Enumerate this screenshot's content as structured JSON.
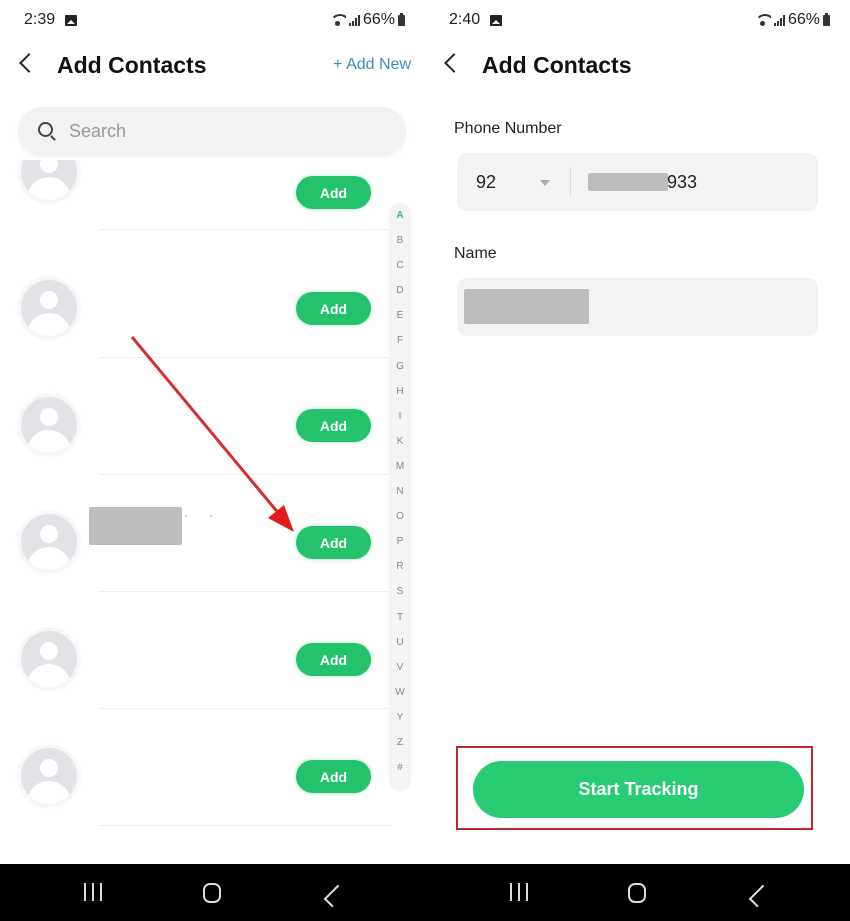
{
  "left_screen": {
    "status_bar": {
      "time": "2:39",
      "battery": "66%"
    },
    "header": {
      "title": "Add Contacts",
      "add_new": "+ Add New"
    },
    "search": {
      "placeholder": "Search"
    },
    "contacts": [
      {
        "name": "",
        "add_label": "Add"
      },
      {
        "name": "",
        "add_label": "Add"
      },
      {
        "name": "",
        "add_label": "Add"
      },
      {
        "name": "[redacted]",
        "add_label": "Add",
        "highlighted": true
      },
      {
        "name": "",
        "add_label": "Add"
      },
      {
        "name": "",
        "add_label": "Add"
      }
    ],
    "index_letters": [
      "A",
      "B",
      "C",
      "D",
      "E",
      "F",
      "G",
      "H",
      "I",
      "K",
      "M",
      "N",
      "O",
      "P",
      "R",
      "S",
      "T",
      "U",
      "V",
      "W",
      "Y",
      "Z",
      "#"
    ],
    "active_index": "A",
    "annotation": {
      "type": "arrow",
      "color": "#d32f2f",
      "target": "Add button of 4th contact"
    }
  },
  "right_screen": {
    "status_bar": {
      "time": "2:40",
      "battery": "66%"
    },
    "header": {
      "title": "Add Contacts"
    },
    "phone": {
      "label": "Phone Number",
      "country_code": "92",
      "number_visible_suffix": "933"
    },
    "name": {
      "label": "Name",
      "value": "[redacted]"
    },
    "start_button": {
      "label": "Start Tracking"
    },
    "annotation": {
      "type": "highlight-box",
      "color": "#c0272d",
      "target": "Start Tracking button"
    }
  },
  "colors": {
    "accent_green": "#23c26b",
    "link_blue": "#3b8dbd",
    "annotation_red": "#d32f2f"
  }
}
